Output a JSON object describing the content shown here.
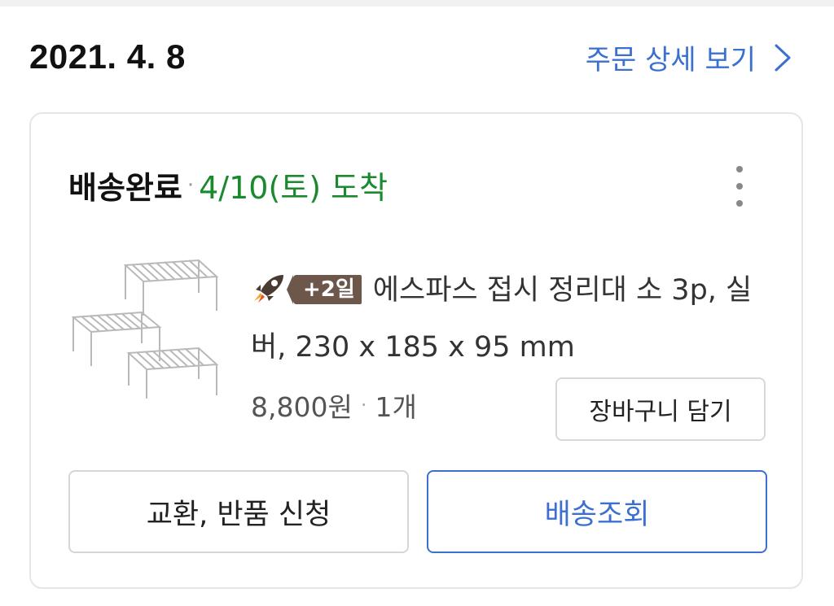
{
  "order": {
    "date": "2021. 4. 8",
    "detail_link_label": "주문 상세 보기"
  },
  "shipment": {
    "status_label": "배송완료",
    "separator": "·",
    "arrival_text": "4/10(토) 도착"
  },
  "product": {
    "delivery_badge": "+2일",
    "title": "에스파스 접시 정리대 소 3p, 실버, 230 x 185 x 95 mm",
    "price": "8,800원",
    "separator": "·",
    "quantity": "1개"
  },
  "buttons": {
    "add_to_cart": "장바구니 담기",
    "exchange_return": "교환, 반품 신청",
    "track_delivery": "배송조회"
  },
  "colors": {
    "accent_blue": "#3b6fd0",
    "arrival_green": "#1b8a2e",
    "badge_brown": "#6d574b"
  },
  "icons": {
    "detail_link": "chevron-right-icon",
    "more": "more-vertical-icon",
    "delivery": "rocket-icon"
  }
}
